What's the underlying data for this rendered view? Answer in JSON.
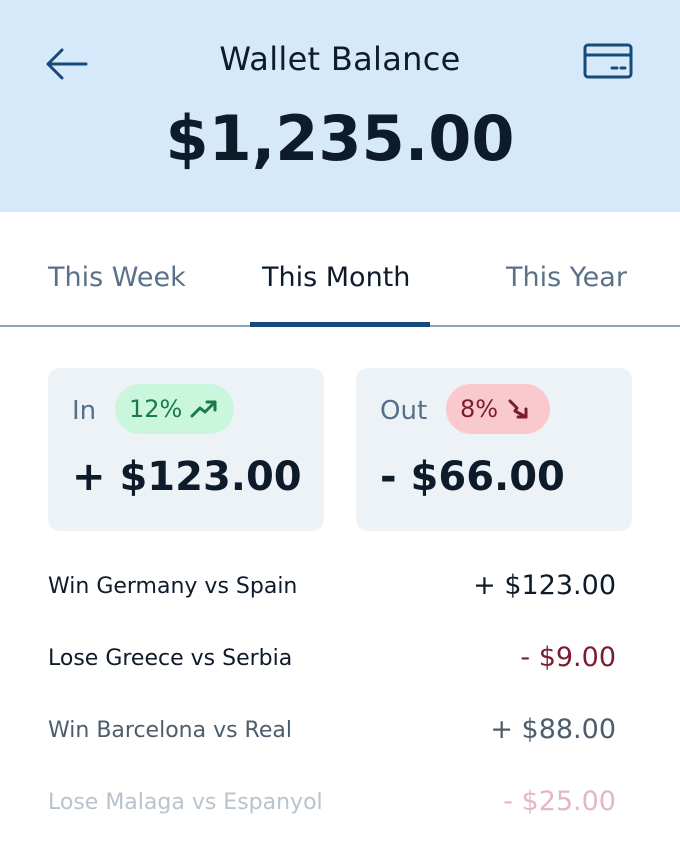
{
  "header": {
    "title": "Wallet Balance",
    "balance": "$1,235.00",
    "back_icon": "arrow-left-icon",
    "card_icon": "credit-card-icon",
    "background": "#d6e9fb"
  },
  "tabs": [
    {
      "label": "This Week",
      "active": false
    },
    {
      "label": "This Month",
      "active": true
    },
    {
      "label": "This Year",
      "active": false
    }
  ],
  "summary": {
    "in": {
      "label": "In",
      "percent": "12%",
      "trend_icon": "trending-up-icon",
      "amount": "+ $123.00",
      "badge_color": "#c9f6dc"
    },
    "out": {
      "label": "Out",
      "percent": "8%",
      "trend_icon": "trending-down-icon",
      "amount": "- $66.00",
      "badge_color": "#f9c9cd"
    }
  },
  "transactions": [
    {
      "label": "Win Germany vs Spain",
      "amount": "+ $123.00",
      "type": "win"
    },
    {
      "label": "Lose Greece vs Serbia",
      "amount": "- $9.00",
      "type": "lose"
    },
    {
      "label": "Win Barcelona vs Real",
      "amount": "+ $88.00",
      "type": "win"
    },
    {
      "label": "Lose Malaga vs Espanyol",
      "amount": "- $25.00",
      "type": "lose"
    }
  ],
  "colors": {
    "accent": "#164a7a",
    "text_dark": "#0d1b2a",
    "loss": "#7a1d33",
    "gain_badge_text": "#1b7a4a"
  }
}
